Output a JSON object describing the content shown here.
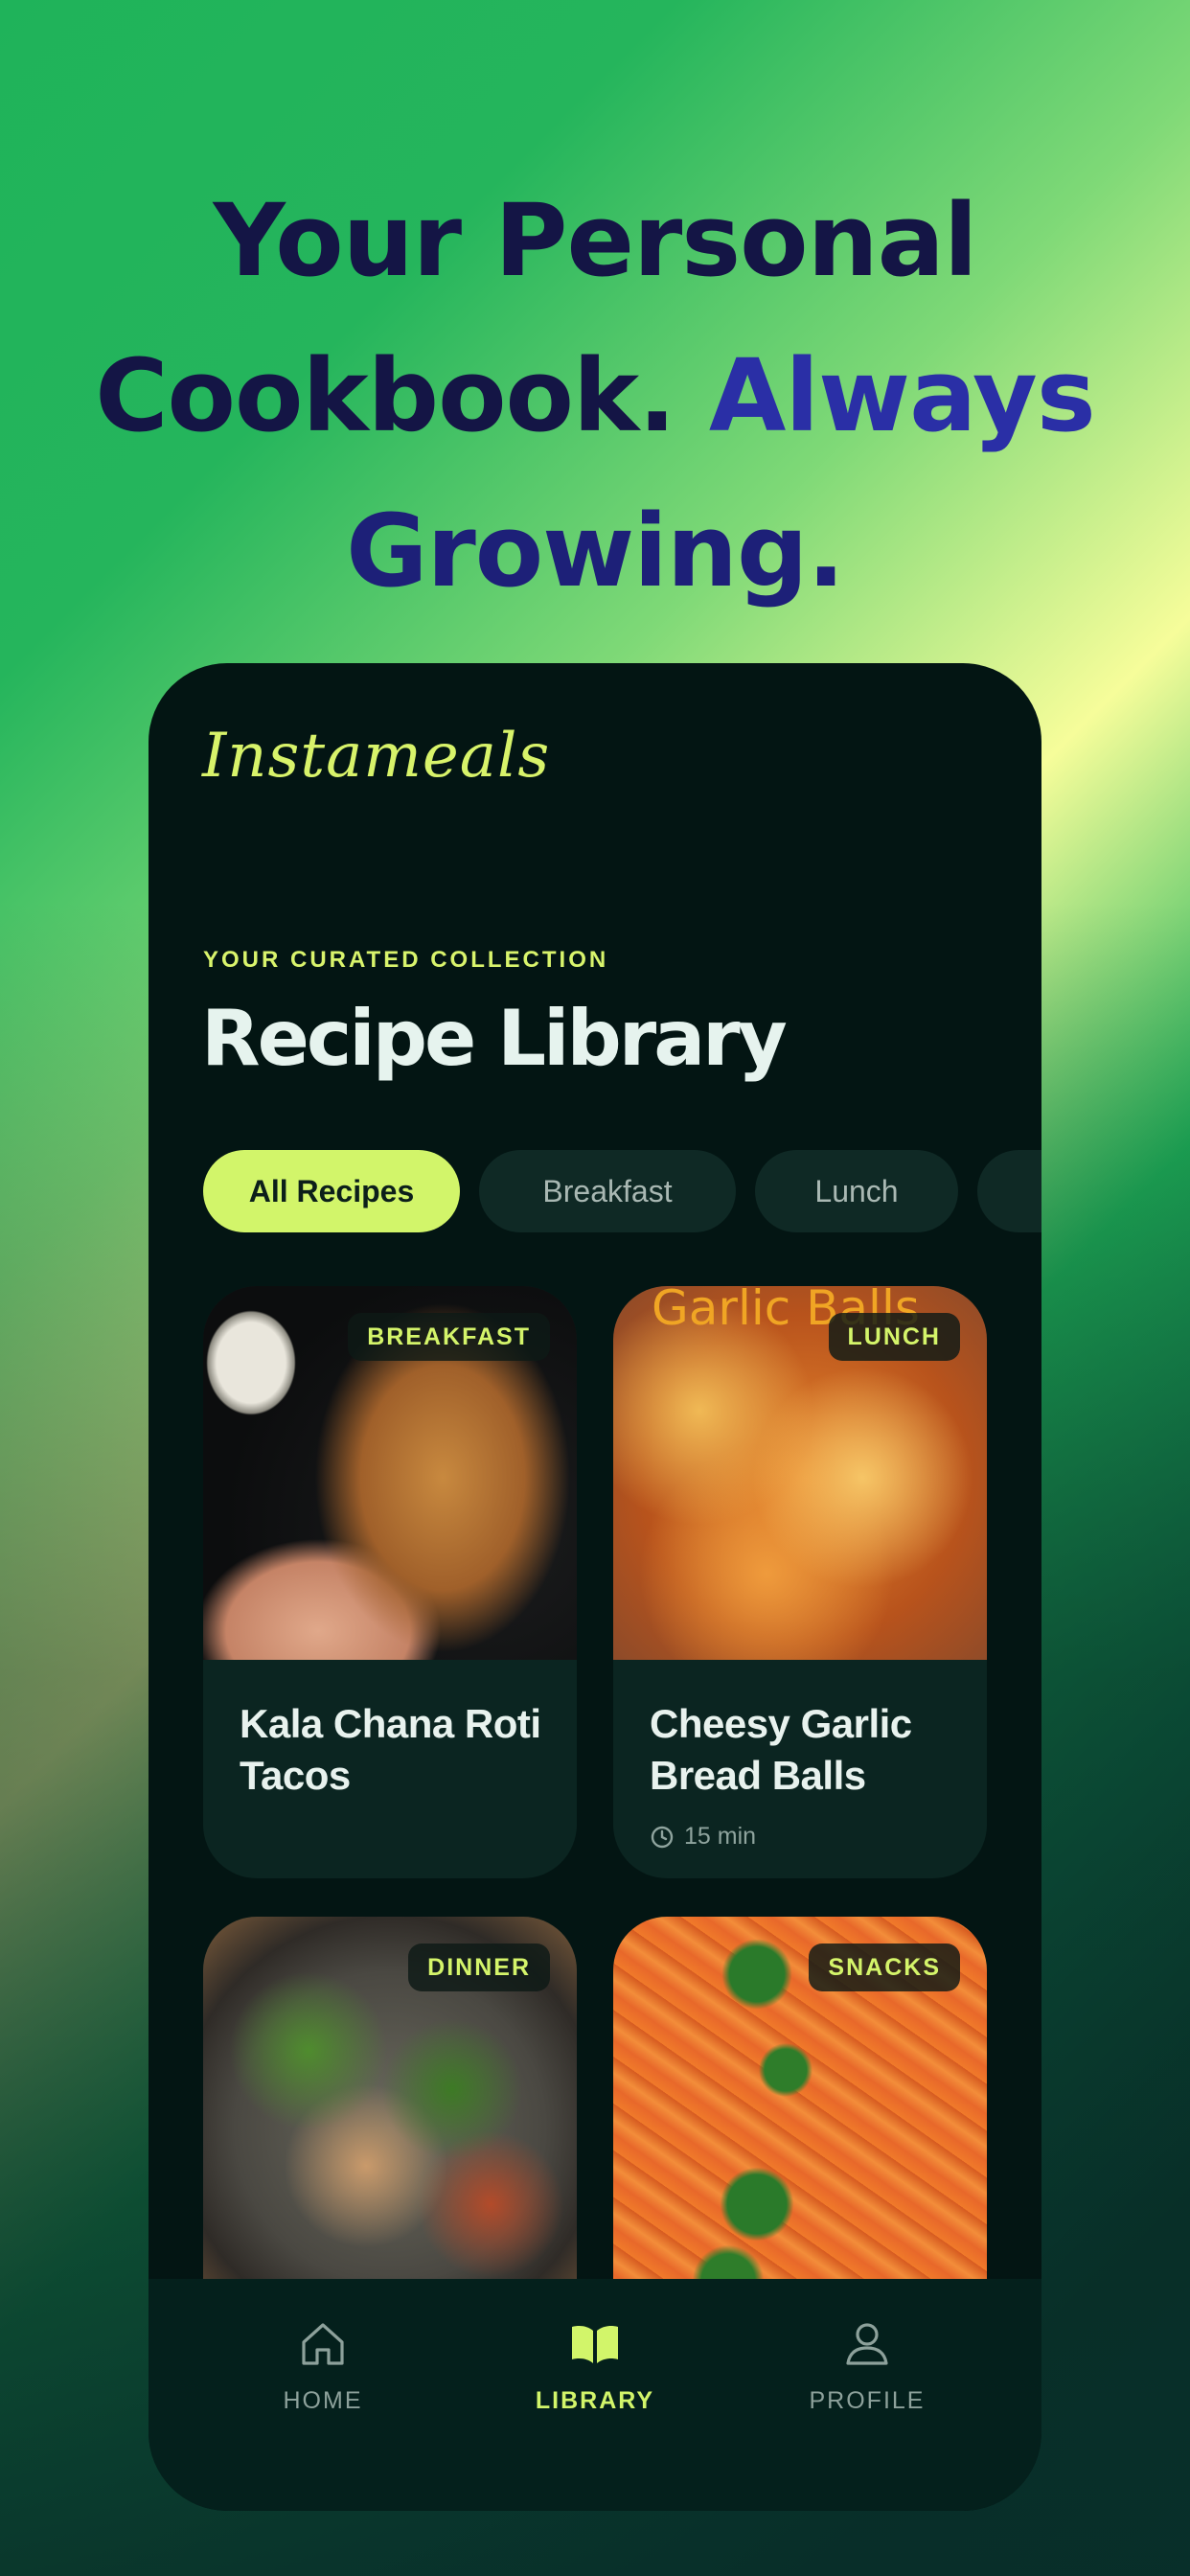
{
  "headline": {
    "line1": "Your Personal",
    "line2a": "Cookbook.",
    "line2b": "Always",
    "line3": "Growing."
  },
  "app": {
    "logo": "Instameals",
    "eyebrow": "YOUR CURATED COLLECTION",
    "title": "Recipe Library"
  },
  "chips": [
    {
      "label": "All Recipes",
      "active": true
    },
    {
      "label": "Breakfast",
      "active": false
    },
    {
      "label": "Lunch",
      "active": false
    },
    {
      "label": "",
      "active": false
    }
  ],
  "recipes": [
    {
      "badge": "BREAKFAST",
      "title": "Kala Chana Roti Tacos",
      "image": "roti-tacos-photo"
    },
    {
      "badge": "LUNCH",
      "title": "Cheesy Garlic Bread Balls",
      "time": "15 min",
      "image": "garlic-bread-balls-photo",
      "image_overlay_text": "Garlic Balls"
    },
    {
      "badge": "DINNER",
      "title": "",
      "image": "paneer-broccoli-bowl-photo"
    },
    {
      "badge": "SNACKS",
      "title": "",
      "image": "spicy-pasta-jalapeno-photo"
    }
  ],
  "nav": [
    {
      "label": "HOME",
      "icon": "home-icon",
      "active": false
    },
    {
      "label": "LIBRARY",
      "icon": "book-icon",
      "active": true
    },
    {
      "label": "PROFILE",
      "icon": "person-icon",
      "active": false
    }
  ],
  "colors": {
    "accent": "#d2f56a",
    "phone_bg": "#031513",
    "card_bg": "#0b2521"
  }
}
